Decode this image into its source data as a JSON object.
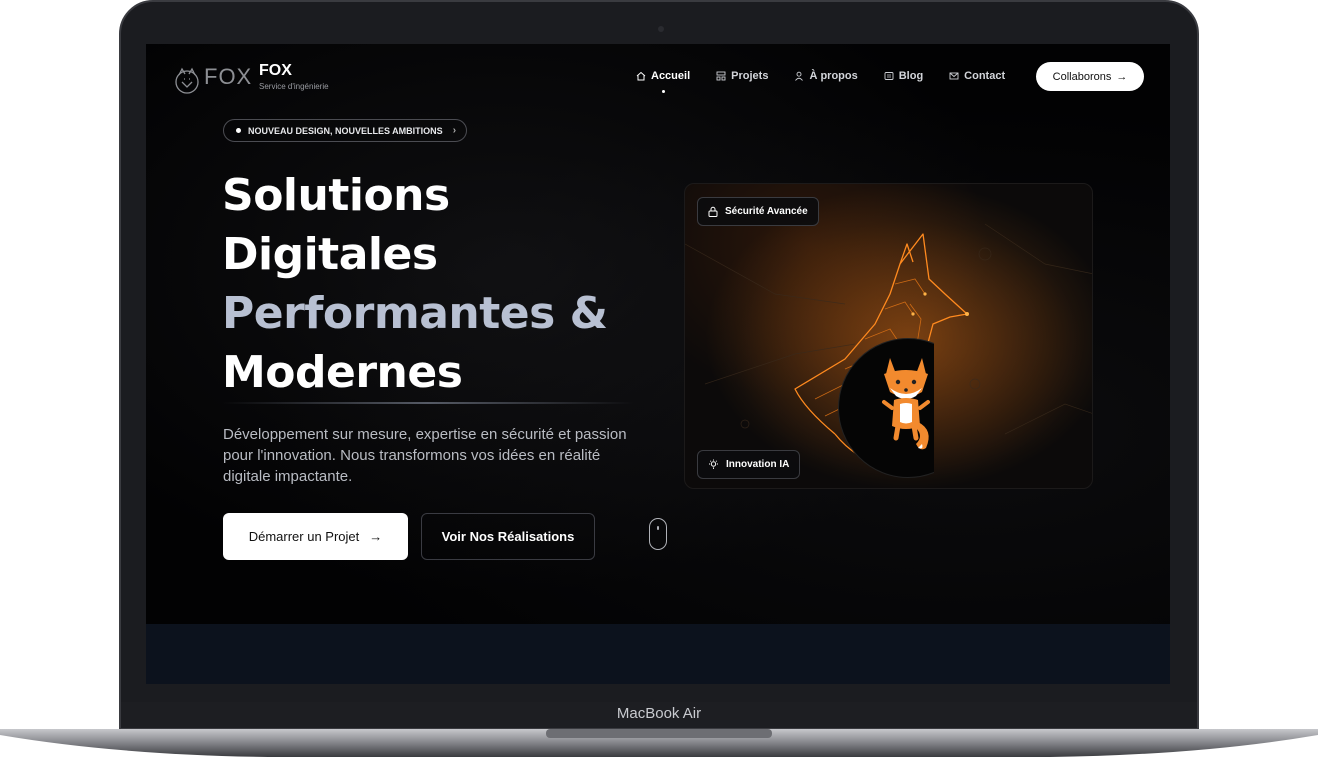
{
  "device": {
    "model_label": "MacBook Air"
  },
  "brand": {
    "logo_word": "FOX",
    "name": "FOX",
    "tagline": "Service d'ingénierie"
  },
  "nav": {
    "items": [
      {
        "label": "Accueil",
        "icon": "home-icon",
        "active": true
      },
      {
        "label": "Projets",
        "icon": "layout-icon",
        "active": false
      },
      {
        "label": "À propos",
        "icon": "user-icon",
        "active": false
      },
      {
        "label": "Blog",
        "icon": "newspaper-icon",
        "active": false
      },
      {
        "label": "Contact",
        "icon": "mail-icon",
        "active": false
      }
    ],
    "cta": {
      "label": "Collaborons",
      "icon": "arrow-right-icon"
    }
  },
  "hero": {
    "badge": "NOUVEAU DESIGN, NOUVELLES AMBITIONS",
    "headline": {
      "line1": "Solutions",
      "line2": "Digitales",
      "line3": "Performantes &",
      "line4": "Modernes"
    },
    "lead": "Développement sur mesure, expertise en sécurité et passion pour l'innovation. Nous transformons vos idées en réalité digitale impactante.",
    "primary_cta": {
      "label": "Démarrer un Projet",
      "icon": "arrow-right-icon"
    },
    "secondary_cta": {
      "label": "Voir Nos Réalisations"
    },
    "card": {
      "chip_security": {
        "label": "Sécurité Avancée",
        "icon": "lock-icon"
      },
      "chip_ai": {
        "label": "Innovation IA",
        "icon": "lightbulb-icon"
      }
    }
  },
  "colors": {
    "background": "#020203",
    "accent_orange": "#ff8a1f",
    "headline_grey": "#b8c0d2",
    "bottom_band": "#0c121d"
  }
}
